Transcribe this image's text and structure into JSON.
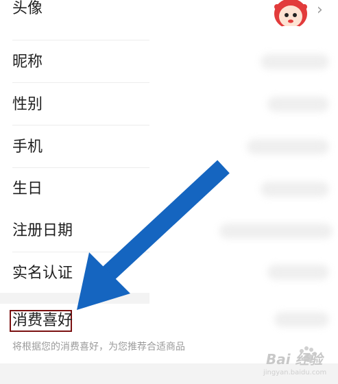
{
  "profile": {
    "rows": [
      {
        "label": "头像"
      },
      {
        "label": "昵称"
      },
      {
        "label": "性别"
      },
      {
        "label": "手机"
      },
      {
        "label": "生日"
      },
      {
        "label": "注册日期"
      },
      {
        "label": "实名认证"
      },
      {
        "label": "消费喜好"
      }
    ],
    "preference_hint": "将根据您的消费喜好，为您推荐合适商品",
    "chevron": "›"
  },
  "watermark": {
    "brand": "Bai 经验",
    "sub": "jingyan.baidu.com"
  },
  "colors": {
    "arrow": "#1565c0",
    "highlight_border": "#7a1010",
    "divider": "#ececec"
  },
  "icons": [
    "avatar-icon",
    "chevron-right-icon",
    "baidu-paw-icon"
  ]
}
